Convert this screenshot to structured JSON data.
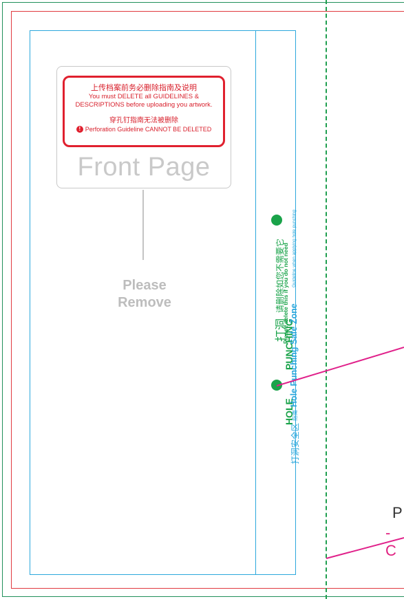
{
  "notice": {
    "line_cn_1": "上传档案前务必删除指南及说明",
    "line_en_1": "You must DELETE all GUIDELINES &",
    "line_en_2": "DESCRIPTIONS before uploading you artwork.",
    "line_cn_2": "穿孔钉指南无法被删除",
    "line_en_3": "Perforation Guideline CANNOT BE DELETED",
    "warn_icon": "!"
  },
  "front_page": {
    "title": "Front Page"
  },
  "please_remove": {
    "line1": "Please",
    "line2": "Remove"
  },
  "hole_punch": {
    "hole_label": "HOLE",
    "punching_label": "PUNCHING",
    "cn_dadong": "打洞",
    "cn_delete": "请删除如您不需要它",
    "en_delete": "Please delete this if you do not need",
    "safe_cn": "打洞安全区",
    "safe_cn_guide": "指南",
    "safe_en": "Hole Punching Safe Zone",
    "safe_guide_en": "Guideline when applying hole punching"
  },
  "partial_right": {
    "text1": "P",
    "text2": "- C"
  },
  "colors": {
    "green": "#1aa34a",
    "cyan": "#2aa7dc",
    "red": "#e0202e",
    "pink": "#e0208a",
    "grey": "#c4c4c4"
  }
}
